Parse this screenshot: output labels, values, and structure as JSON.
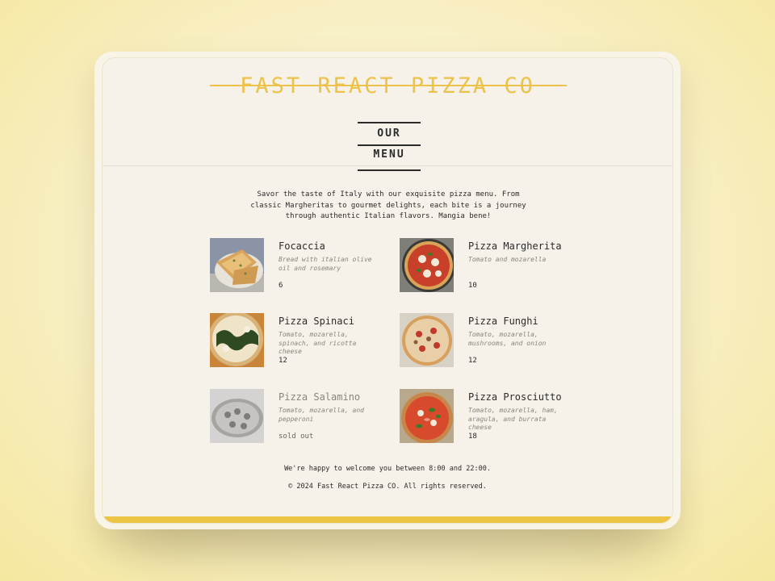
{
  "header": {
    "logo": "FAST REACT PIZZA CO",
    "menu_title": "OUR MENU"
  },
  "intro": "Savor the taste of Italy with our exquisite pizza menu. From classic Margheritas to gourmet delights, each bite is a journey through authentic Italian flavors. Mangia bene!",
  "menu": {
    "items": [
      {
        "name": "Focaccia",
        "description": "Bread with italian olive oil and rosemary",
        "price": "6",
        "sold_out": false
      },
      {
        "name": "Pizza Margherita",
        "description": "Tomato and mozarella",
        "price": "10",
        "sold_out": false
      },
      {
        "name": "Pizza Spinaci",
        "description": "Tomato, mozarella, spinach, and ricotta cheese",
        "price": "12",
        "sold_out": false
      },
      {
        "name": "Pizza Funghi",
        "description": "Tomato, mozarella, mushrooms, and onion",
        "price": "12",
        "sold_out": false
      },
      {
        "name": "Pizza Salamino",
        "description": "Tomato, mozarella, and pepperoni",
        "price": "sold out",
        "sold_out": true
      },
      {
        "name": "Pizza Prosciutto",
        "description": "Tomato, mozarella, ham, aragula, and burrata cheese",
        "price": "18",
        "sold_out": false
      }
    ]
  },
  "footer": {
    "hours": "We're happy to welcome you between 8:00 and 22:00.",
    "copyright": "© 2024 Fast React Pizza CO. All rights reserved."
  },
  "colors": {
    "accent": "#edc24b",
    "background": "#f6f2e9",
    "text": "#2b2b2b",
    "muted": "#8a8578"
  }
}
